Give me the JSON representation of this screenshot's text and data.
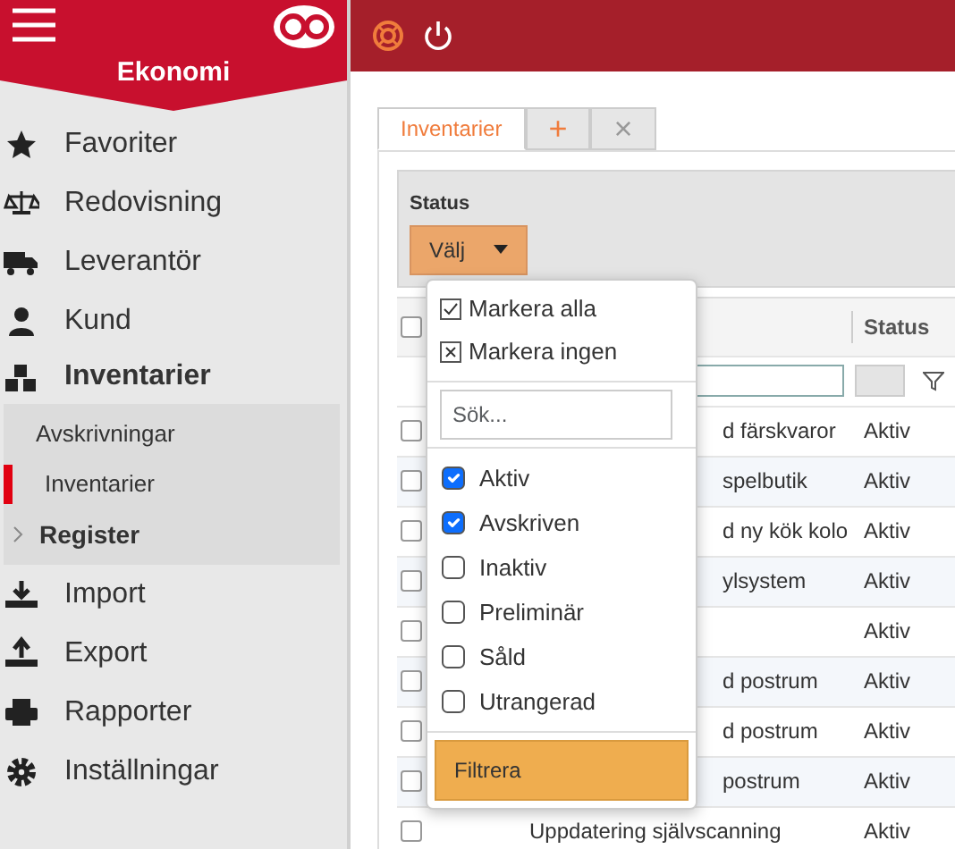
{
  "header": {
    "module_title": "Ekonomi"
  },
  "sidebar": {
    "items": [
      {
        "label": "Favoriter",
        "expanded": false
      },
      {
        "label": "Redovisning",
        "expanded": false
      },
      {
        "label": "Leverantör",
        "expanded": false
      },
      {
        "label": "Kund",
        "expanded": false
      },
      {
        "label": "Inventarier",
        "expanded": true,
        "children": [
          {
            "label": "Avskrivningar",
            "selected": false
          },
          {
            "label": "Inventarier",
            "selected": true
          },
          {
            "label": "Register",
            "kind": "group",
            "expanded": false
          }
        ]
      },
      {
        "label": "Import",
        "expanded": false
      },
      {
        "label": "Export",
        "expanded": false
      },
      {
        "label": "Rapporter",
        "expanded": false
      },
      {
        "label": "Inställningar",
        "expanded": false
      }
    ]
  },
  "tabs": [
    {
      "label": "Inventarier",
      "selected": true,
      "kind": "tab"
    },
    {
      "label": "+",
      "selected": false,
      "kind": "add"
    },
    {
      "label": "×",
      "selected": false,
      "kind": "close"
    }
  ],
  "filter": {
    "label": "Status",
    "button": "Välj"
  },
  "dropdown": {
    "actions": [
      {
        "label": "Markera alla",
        "kind": "all"
      },
      {
        "label": "Markera ingen",
        "kind": "none"
      }
    ],
    "search": {
      "placeholder": "Sök..."
    },
    "options": [
      {
        "label": "Aktiv",
        "checked": true
      },
      {
        "label": "Avskriven",
        "checked": true
      },
      {
        "label": "Inaktiv",
        "checked": false
      },
      {
        "label": "Preliminär",
        "checked": false
      },
      {
        "label": "Såld",
        "checked": false
      },
      {
        "label": "Utrangerad",
        "checked": false
      }
    ],
    "button": "Filtrera"
  },
  "table": {
    "select_all": {
      "checked": false
    },
    "columns": [
      "Status"
    ],
    "rows": [
      {
        "name": "d färskvaror",
        "status": "Aktiv",
        "checked": false
      },
      {
        "name": "spelbutik",
        "status": "Aktiv",
        "checked": false
      },
      {
        "name": "d ny kök kolo",
        "status": "Aktiv",
        "checked": false
      },
      {
        "name": "ylsystem",
        "status": "Aktiv",
        "checked": false
      },
      {
        "status": "Aktiv",
        "checked": false
      },
      {
        "name": "d postrum",
        "status": "Aktiv",
        "checked": false
      },
      {
        "name": "d postrum",
        "status": "Aktiv",
        "checked": false
      },
      {
        "name": "postrum",
        "status": "Aktiv",
        "checked": false
      },
      {
        "name": "Uppdatering självscanning",
        "status": "Aktiv",
        "checked": false
      }
    ]
  }
}
